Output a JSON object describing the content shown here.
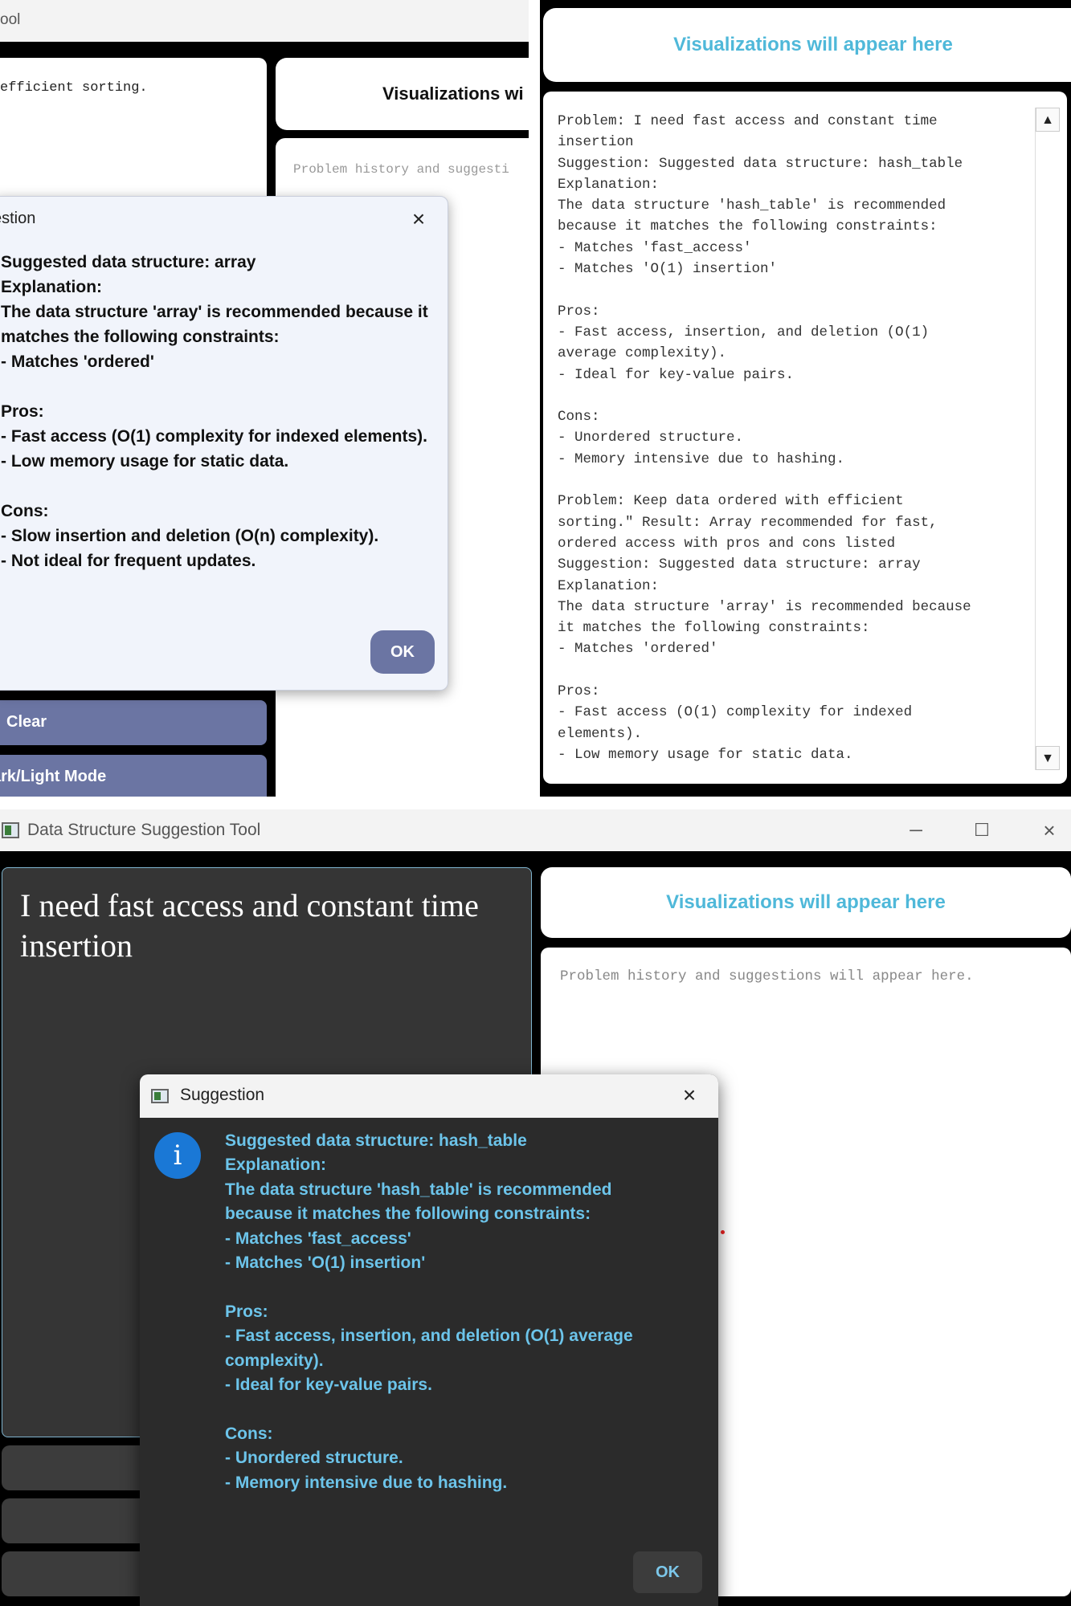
{
  "top_left": {
    "titlebar_fragment": "ool",
    "input_fragment": "efficient sorting.",
    "viz_fragment": "Visualizations wi",
    "history_fragment": "Problem history and suggesti",
    "clear_label": "Clear",
    "mode_label": "ark/Light Mode",
    "dialog": {
      "title_fragment": "estion",
      "close": "×",
      "message": "Suggested data structure: array\nExplanation:\nThe data structure 'array' is recommended because it\nmatches the following constraints:\n- Matches 'ordered'\n\nPros:\n- Fast access (O(1) complexity for indexed elements).\n- Low memory usage for static data.\n\nCons:\n- Slow insertion and deletion (O(n) complexity).\n- Not ideal for frequent updates.",
      "ok_label": "OK"
    }
  },
  "top_right": {
    "viz_label": "Visualizations will appear here",
    "history": "Problem: I need fast access and constant time\ninsertion\nSuggestion: Suggested data structure: hash_table\nExplanation:\nThe data structure 'hash_table' is recommended\nbecause it matches the following constraints:\n- Matches 'fast_access'\n- Matches 'O(1) insertion'\n\nPros:\n- Fast access, insertion, and deletion (O(1)\naverage complexity).\n- Ideal for key-value pairs.\n\nCons:\n- Unordered structure.\n- Memory intensive due to hashing.\n\nProblem: Keep data ordered with efficient\nsorting.\" Result: Array recommended for fast,\nordered access with pros and cons listed\nSuggestion: Suggested data structure: array\nExplanation:\nThe data structure 'array' is recommended because\nit matches the following constraints:\n- Matches 'ordered'\n\nPros:\n- Fast access (O(1) complexity for indexed\nelements).\n- Low memory usage for static data.",
    "scroll_up": "▲",
    "scroll_down": "▼"
  },
  "bottom": {
    "window_title": "Data Structure Suggestion Tool",
    "min_icon": "─",
    "max_icon": "☐",
    "close_icon": "×",
    "input_value": "I need fast access and constant time insertion",
    "viz_label": "Visualizations will appear here",
    "history_placeholder": "Problem history and suggestions will appear here.",
    "dialog": {
      "title": "Suggestion",
      "close": "×",
      "info_icon": "i",
      "message": "Suggested data structure: hash_table\nExplanation:\nThe data structure 'hash_table' is recommended\nbecause it matches the following constraints:\n- Matches 'fast_access'\n- Matches 'O(1) insertion'\n\nPros:\n- Fast access, insertion, and deletion (O(1) average\ncomplexity).\n- Ideal for key-value pairs.\n\nCons:\n- Unordered structure.\n- Memory intensive due to hashing.",
      "ok_label": "OK"
    }
  },
  "colors": {
    "accent_light_button": "#6b75a3",
    "visualization_text": "#4fb8d9",
    "dark_dialog_text": "#6cc4ea",
    "dark_panel": "#353535"
  }
}
